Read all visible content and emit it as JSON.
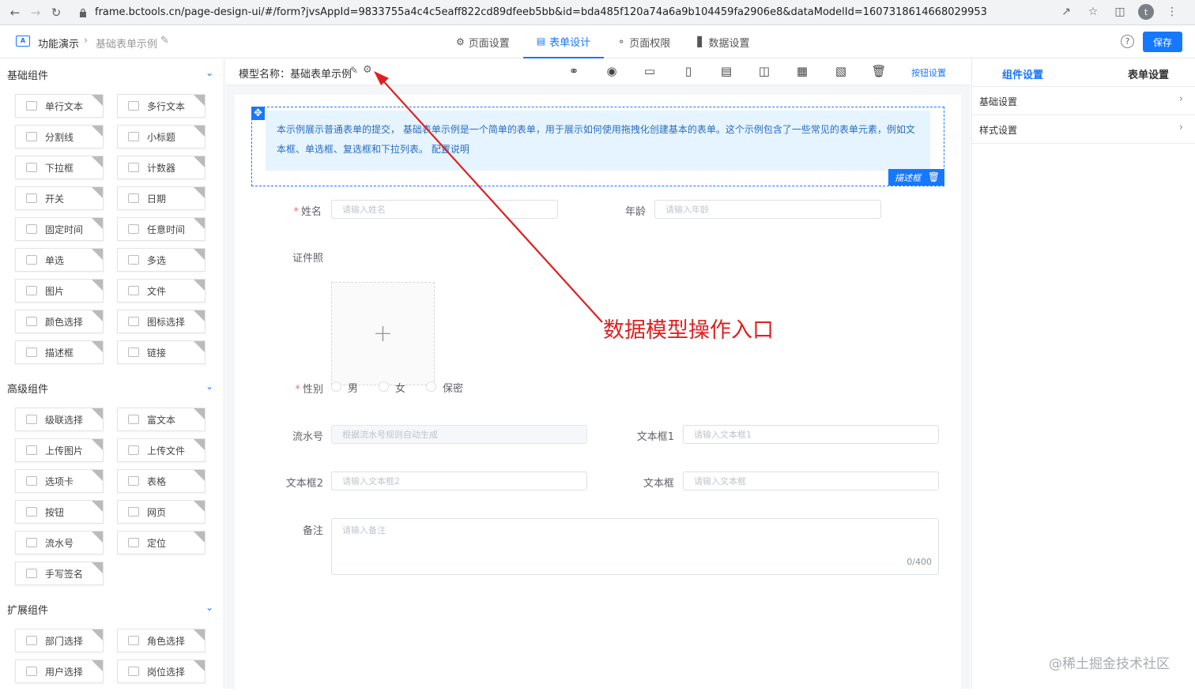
{
  "browser": {
    "url": "frame.bctools.cn/page-design-ui/#/form?jvsAppId=9833755a4c4c5eaff822cd89dfeeb5bb&id=bda485f120a74a6a9b104459fa2906e8&dataModelId=1607318614668029953",
    "profile_initial": "t"
  },
  "header": {
    "app_name": "功能演示",
    "form_name": "基础表单示例",
    "tabs": [
      {
        "label": "页面设置",
        "icon": "gear-icon"
      },
      {
        "label": "表单设计",
        "icon": "document-icon"
      },
      {
        "label": "页面权限",
        "icon": "key-icon"
      },
      {
        "label": "数据设置",
        "icon": "bar-chart-icon"
      }
    ],
    "active_tab": "表单设计",
    "save_label": "保存"
  },
  "left": {
    "basic_title": "基础组件",
    "basic": [
      "单行文本",
      "多行文本",
      "分割线",
      "小标题",
      "下拉框",
      "计数器",
      "开关",
      "日期",
      "固定时间",
      "任意时间",
      "单选",
      "多选",
      "图片",
      "文件",
      "颜色选择",
      "图标选择",
      "描述框",
      "链接"
    ],
    "advanced_title": "高级组件",
    "advanced": [
      "级联选择",
      "富文本",
      "上传图片",
      "上传文件",
      "选项卡",
      "表格",
      "按钮",
      "网页",
      "流水号",
      "定位",
      "手写签名"
    ],
    "extended_title": "扩展组件",
    "extended": [
      "部门选择",
      "角色选择",
      "用户选择",
      "岗位选择"
    ]
  },
  "toolbar": {
    "model_label": "模型名称：基础表单示例",
    "button_settings": "按钮设置"
  },
  "form": {
    "description": "本示例展示普通表单的提交， 基础表单示例是一个简单的表单，用于展示如何使用拖拽化创建基本的表单。这个示例包含了一些常见的表单元素，例如文本框、单选框、复选框和下拉列表。",
    "description_link": "配置说明",
    "desc_tag": "描述框",
    "name_label": "姓名",
    "name_placeholder": "请输入姓名",
    "age_label": "年龄",
    "age_placeholder": "请输入年龄",
    "photo_label": "证件照",
    "gender_label": "性别",
    "gender_options": [
      "男",
      "女",
      "保密"
    ],
    "serial_label": "流水号",
    "serial_placeholder": "根据流水号规则自动生成",
    "text1_label": "文本框1",
    "text1_placeholder": "请输入文本框1",
    "text2_label": "文本框2",
    "text2_placeholder": "请输入文本框2",
    "text_label": "文本框",
    "text_placeholder": "请输入文本框",
    "remark_label": "备注",
    "remark_placeholder": "请输入备注",
    "remark_count": "0/400"
  },
  "annotation": {
    "text": "数据模型操作入口",
    "color": "#e02020"
  },
  "right": {
    "tabs": [
      "组件设置",
      "表单设置"
    ],
    "items": [
      "基础设置",
      "样式设置"
    ]
  },
  "watermark": "@稀土掘金技术社区",
  "colors": {
    "accent": "#1677ff",
    "desc_bg": "#e6f4ff"
  }
}
